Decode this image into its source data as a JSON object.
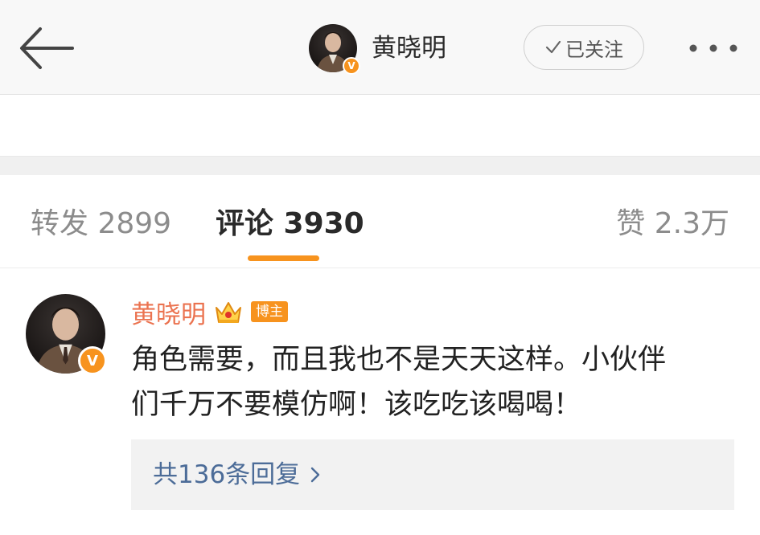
{
  "header": {
    "back_icon": "arrow-left-icon",
    "user_name": "黄晓明",
    "verified_badge": "V",
    "follow_label": "已关注",
    "follow_icon": "check-icon",
    "more_icon": "more-dots-icon"
  },
  "tabs": [
    {
      "label": "转发 2899",
      "active": false
    },
    {
      "label": "评论 3930",
      "active": true
    },
    {
      "label": "赞 2.3万",
      "active": false
    }
  ],
  "comment": {
    "author": "黄晓明",
    "verified_badge": "V",
    "crown_icon": "crown-icon",
    "tag": "博主",
    "lines": [
      "角色需要，而且我也不是天天这样。小伙伴",
      "们千万不要模仿啊！该吃吃该喝喝！"
    ],
    "replies_label": "共136条回复",
    "replies_icon": "chevron-right-icon"
  },
  "colors": {
    "accent": "#f7931e",
    "author_name": "#eb7350",
    "link": "#4c6c98",
    "header_bg": "#f8f8f8"
  }
}
